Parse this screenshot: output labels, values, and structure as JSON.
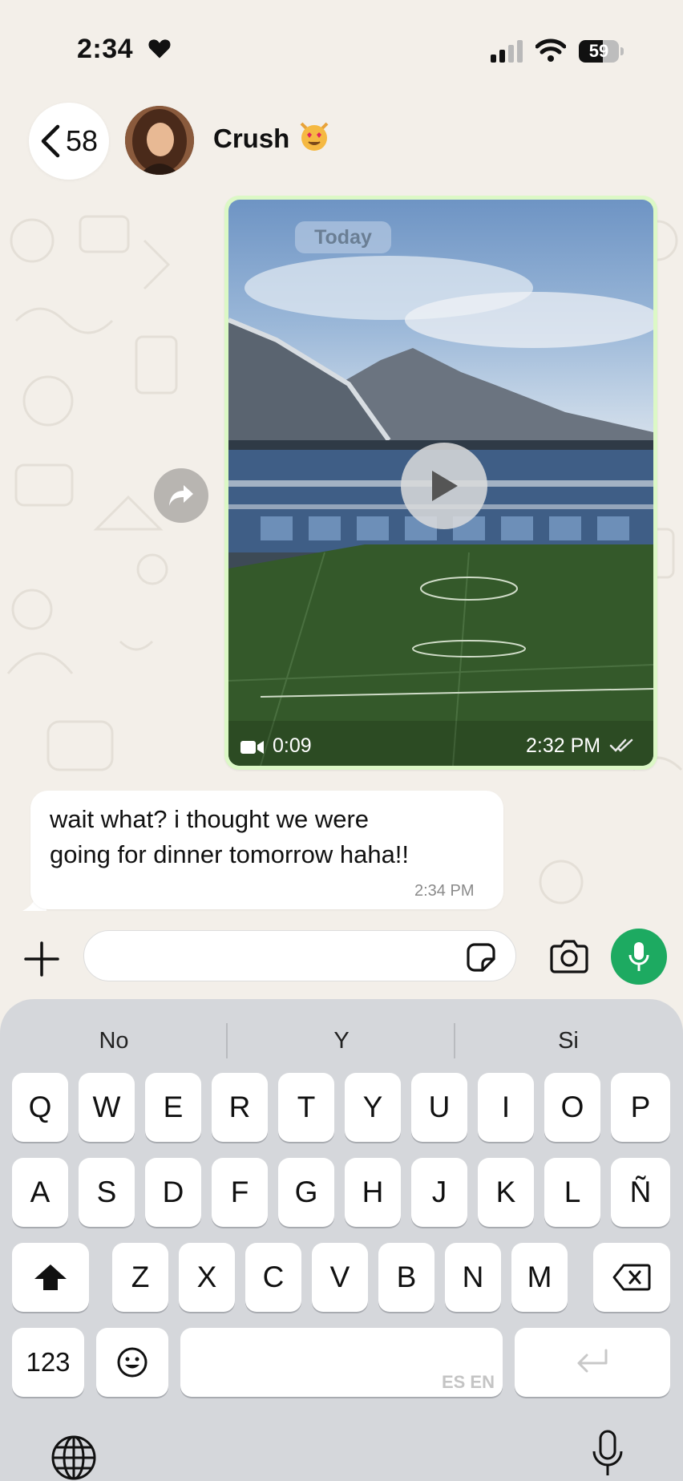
{
  "status_bar": {
    "time": "2:34",
    "battery": "59",
    "battery_level": 0.59
  },
  "header": {
    "back_count": "58",
    "contact_name": "Crush",
    "contact_emoji": "heart-eyes-cat"
  },
  "messages": {
    "video": {
      "date_pill": "Today",
      "duration": "0:09",
      "time": "2:32 PM",
      "status": "read"
    },
    "incoming": {
      "text_line1": "wait what? i thought we were",
      "text_line2": "going for dinner tomorrow haha!!",
      "time": "2:34 PM"
    }
  },
  "composer": {
    "placeholder": ""
  },
  "keyboard": {
    "suggestions": [
      "No",
      "Y",
      "Si"
    ],
    "row1": [
      "Q",
      "W",
      "E",
      "R",
      "T",
      "Y",
      "U",
      "I",
      "O",
      "P"
    ],
    "row2": [
      "A",
      "S",
      "D",
      "F",
      "G",
      "H",
      "J",
      "K",
      "L",
      "Ñ"
    ],
    "row3": [
      "Z",
      "X",
      "C",
      "V",
      "B",
      "N",
      "M"
    ],
    "numbers_key": "123",
    "space_languages": "ES EN"
  },
  "colors": {
    "chat_bg": "#f3efe9",
    "outgoing_bubble": "#dcf8c6",
    "mic_green": "#1daa61",
    "keyboard_bg": "#d5d7db"
  }
}
